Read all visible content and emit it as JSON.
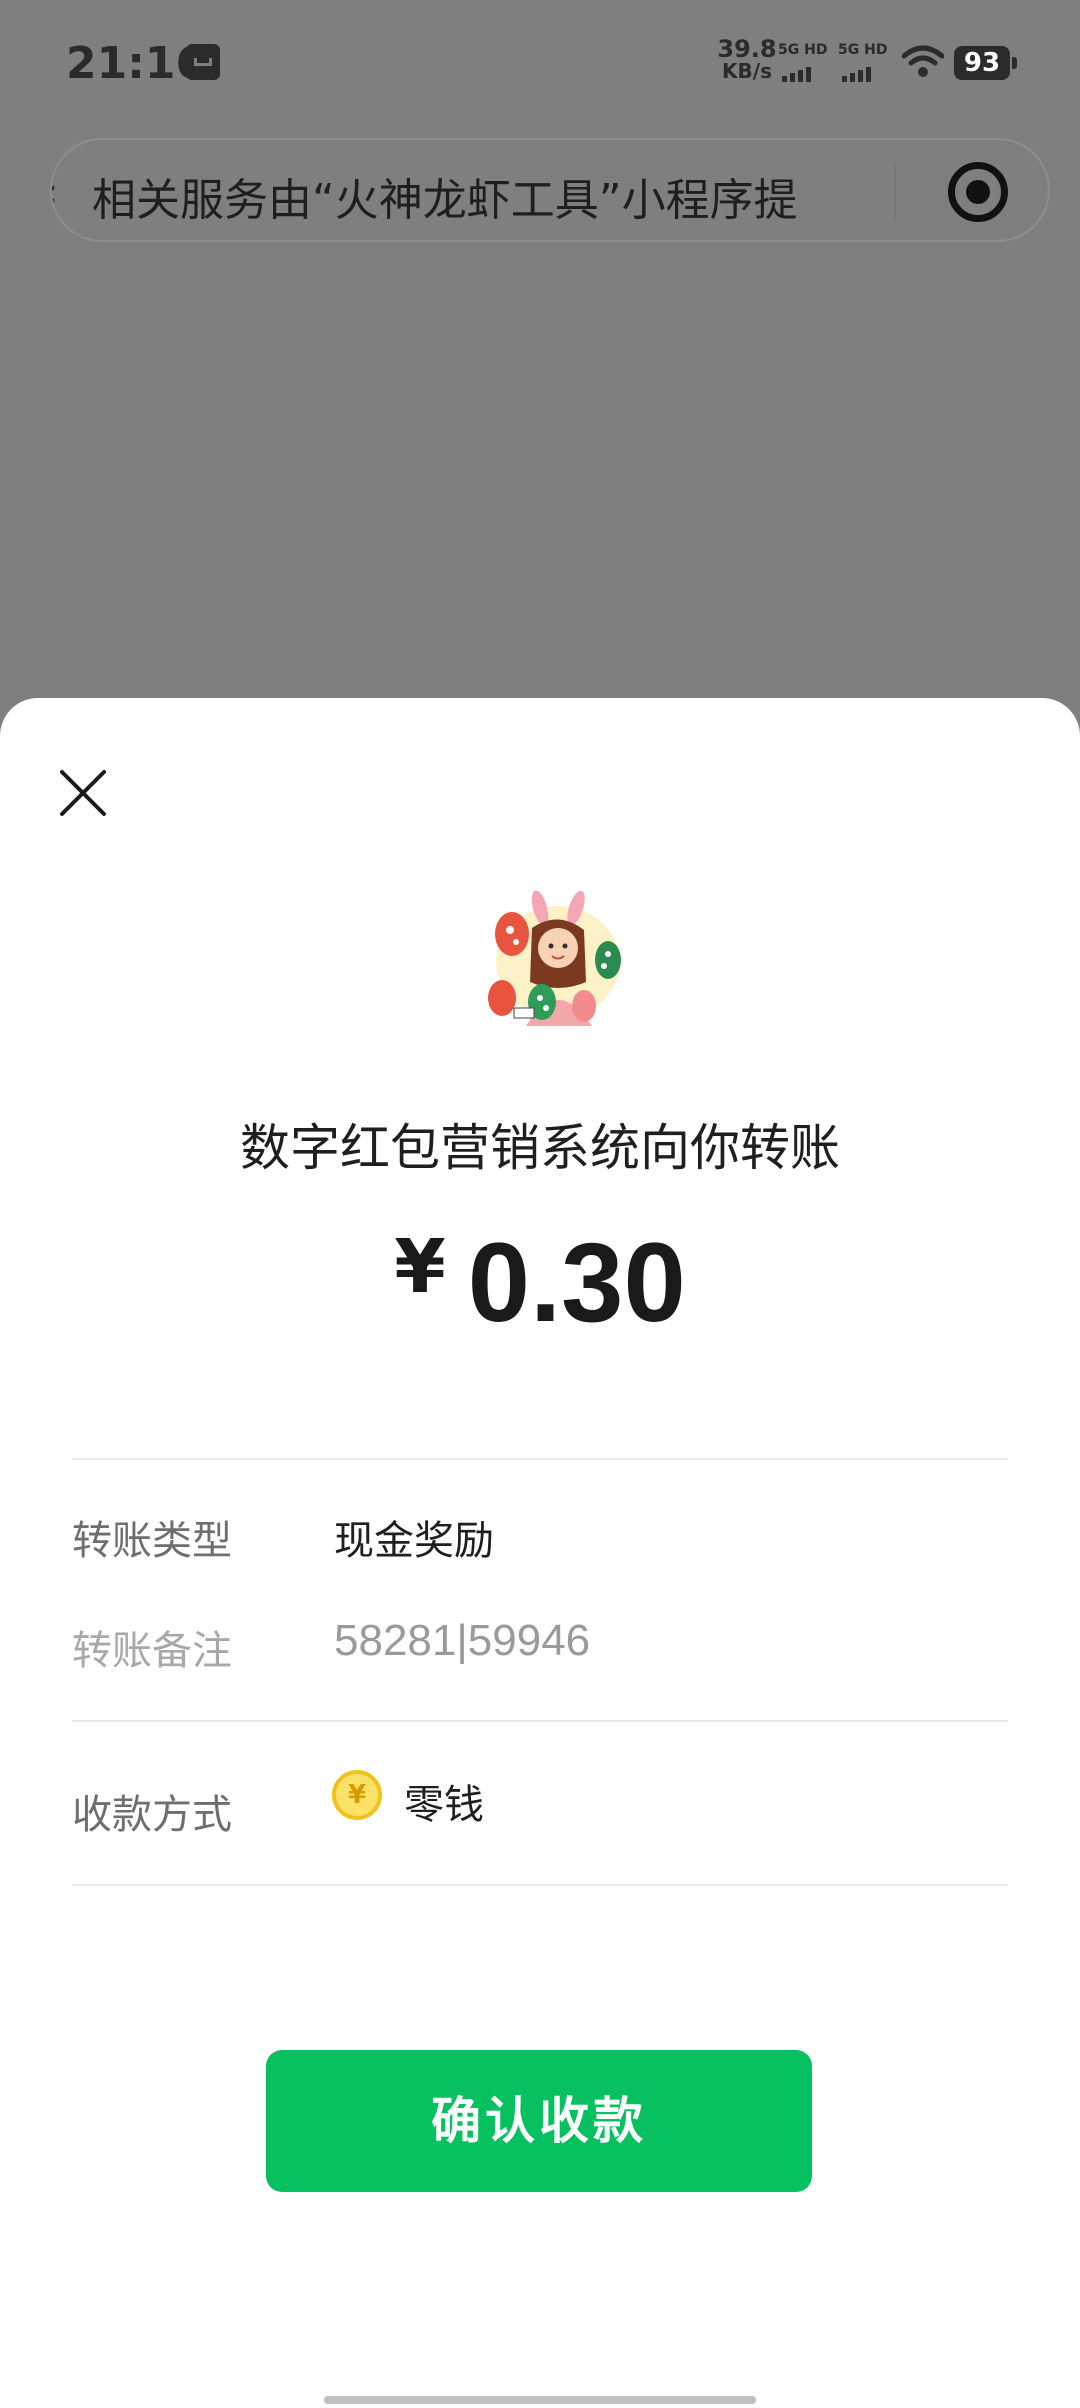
{
  "status_bar": {
    "time": "21:16",
    "net_speed_value": "39.8",
    "net_speed_unit": "KB/s",
    "sim1_label": "5G HD",
    "sim2_label": "5G HD",
    "battery": "93"
  },
  "mini_program_bar": {
    "back_glyph": "‹",
    "text": "相关服务由“火神龙虾工具”小程序提"
  },
  "sheet": {
    "title": "数字红包营销系统向你转账",
    "currency": "¥",
    "amount": "0.30",
    "rows": [
      {
        "label": "转账类型",
        "value": "现金奖励"
      },
      {
        "label": "转账备注",
        "value": "58281|59946"
      },
      {
        "label": "收款方式",
        "value": "零钱"
      }
    ],
    "coin_glyph": "¥",
    "confirm_label": "确认收款"
  },
  "colors": {
    "accent": "#07c160",
    "overlay": "#7f7f7f",
    "coin": "#f9e267"
  },
  "icons": {
    "close": "close-icon",
    "target": "mini-program-capsule-icon",
    "coin": "coin-icon",
    "wifi": "wifi-icon"
  }
}
